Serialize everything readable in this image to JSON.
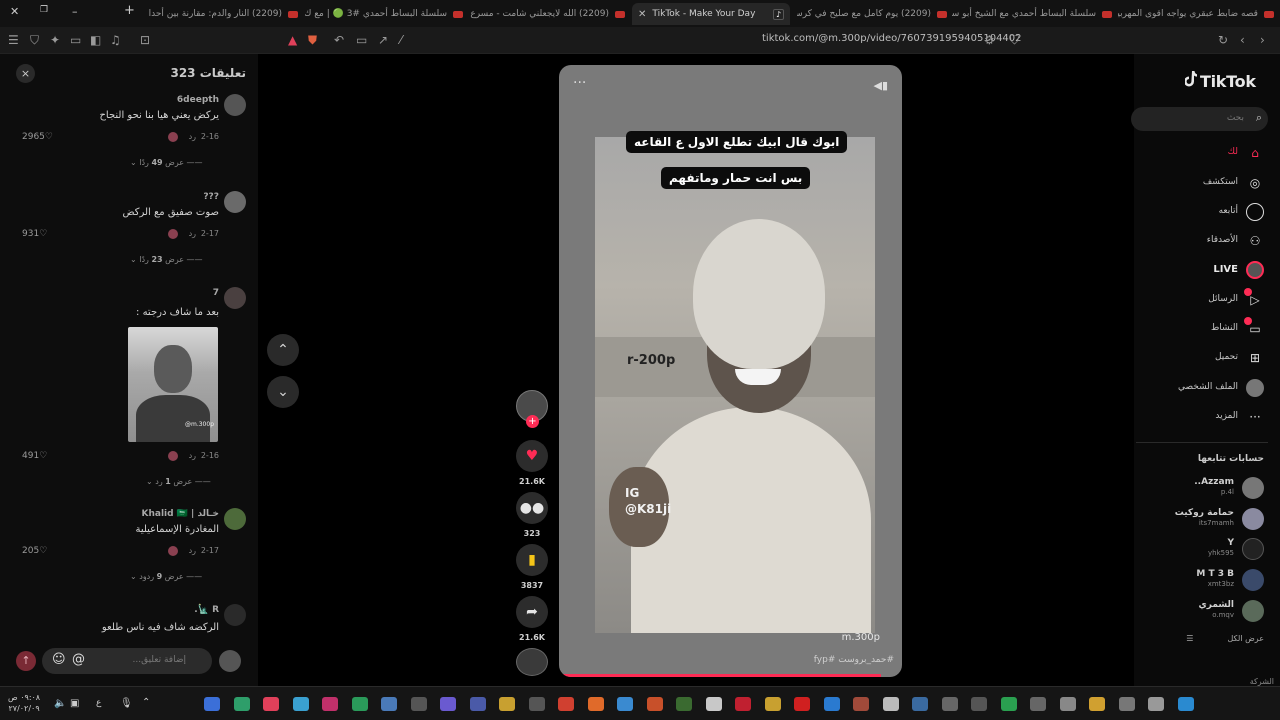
{
  "browser": {
    "tabs": [
      {
        "title": "قصه ضابط عبقري يواجه اقوى المهربين",
        "icon": "youtube-icon"
      },
      {
        "title": "سلسلة البساط أحمدي مع الشيخ أبو سـ",
        "icon": "youtube-icon"
      },
      {
        "title": "(2209) يوم كامل مع صليح في كرسي الا",
        "icon": "youtube-icon"
      },
      {
        "title": "TikTok - Make Your Day",
        "icon": "tiktok-icon",
        "active": true
      },
      {
        "title": "(2209) الله لايجعلني شامت - مسرع - ه",
        "icon": "youtube-icon"
      },
      {
        "title": "سلسلة البساط أحمدي #3 🟢 | مع ك",
        "icon": "youtube-icon"
      },
      {
        "title": "(2209) النار والدم: مقارنة بين أحداث الشـ",
        "icon": "youtube-icon"
      }
    ],
    "url": "tiktok.com/@m.300p/video/7607391959405104402"
  },
  "comments": {
    "title": "تعليقات 323",
    "close": "×",
    "items": [
      {
        "user": "6deepth",
        "text": "يركض يعني هيا بنا نحو النجاح",
        "date": "2-16",
        "reply": "رد",
        "likes": "2965",
        "more_prefix": "عرض",
        "more_count": "49",
        "more_suffix": "ردًا"
      },
      {
        "user": "???",
        "text": "صوت صفيق مع الركض",
        "date": "2-17",
        "reply": "رد",
        "likes": "931",
        "more_prefix": "عرض",
        "more_count": "23",
        "more_suffix": "ردًا"
      },
      {
        "user": "7",
        "text": "بعد ما شاف درجته :",
        "date": "2-16",
        "reply": "رد",
        "likes": "491",
        "more_prefix": "عرض",
        "more_count": "1",
        "more_suffix": "رد",
        "image_watermark": "@m.300p"
      },
      {
        "user": "خـالد | Khalid 🇸🇦",
        "text": "المغادرة الإسماعيلية",
        "date": "2-17",
        "reply": "رد",
        "likes": "205",
        "more_prefix": "عرض",
        "more_count": "9",
        "more_suffix": "ردود"
      },
      {
        "user": "R 🗽.",
        "text": "الركضه شاف فيه ناس طلعو",
        "date": "",
        "reply": "",
        "likes": "",
        "more_prefix": "",
        "more_count": "",
        "more_suffix": ""
      }
    ],
    "input_placeholder": "إضافة تعليق...",
    "at_symbol": "@",
    "emoji_symbol": "☺"
  },
  "video": {
    "caption_line1": "ابوك قال ابيك تطلع الاول ع القاعه",
    "caption_line2": "بس انت حمار وماتفهم",
    "watermark_small": "r-200p",
    "watermark_ig": "IG",
    "watermark_handle": "@K81ji",
    "author_handle": "m.300p",
    "hashtags": "#حمد_بروست #fyp",
    "progress": 0.94
  },
  "actions": {
    "likes": "21.6K",
    "comments": "323",
    "saves": "3837",
    "shares": "21.6K"
  },
  "sidebar": {
    "logo": "TikTok",
    "search_placeholder": "بحث",
    "nav": [
      {
        "label": "لك",
        "icon": "home-icon"
      },
      {
        "label": "استكشف",
        "icon": "compass-icon"
      },
      {
        "label": "أتابعه",
        "icon": "following-icon"
      },
      {
        "label": "الأصدقاء",
        "icon": "friends-icon"
      },
      {
        "label": "LIVE",
        "icon": "live-icon"
      },
      {
        "label": "الرسائل",
        "icon": "messages-icon"
      },
      {
        "label": "النشاط",
        "icon": "activity-icon"
      },
      {
        "label": "تحميل",
        "icon": "upload-icon"
      },
      {
        "label": "الملف الشخصي",
        "icon": "profile-icon"
      },
      {
        "label": "المزيد",
        "icon": "more-icon"
      }
    ],
    "following_title": "حسابات تتابعها",
    "following": [
      {
        "name": "Azzam..",
        "handle": "p.4l"
      },
      {
        "name": "حمامة روكيت",
        "handle": "its7mamh"
      },
      {
        "name": "Y",
        "handle": "yhk595"
      },
      {
        "name": "M T 3 B",
        "handle": "xmt3bz"
      },
      {
        "name": "الشمري",
        "handle": "o.mqv"
      }
    ],
    "see_all": "عرض الكل",
    "company": "الشركة"
  },
  "taskbar": {
    "time": "٠٩:٠٨ ص",
    "date": "٢٧/٠٢/٠٩",
    "lang": "ع"
  }
}
